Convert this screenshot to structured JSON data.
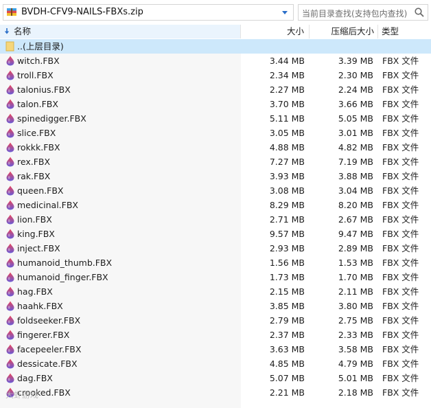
{
  "path": {
    "text": "BVDH-CFV9-NAILS-FBXs.zip"
  },
  "search": {
    "placeholder": "当前目录查找(支持包内查找)"
  },
  "columns": {
    "name": "名称",
    "size": "大小",
    "packed": "压缩后大小",
    "type": "类型"
  },
  "up_row": {
    "label": "..(上层目录)"
  },
  "files": [
    {
      "name": "witch.FBX",
      "size": "3.44 MB",
      "packed": "3.39 MB",
      "type": "FBX 文件"
    },
    {
      "name": "troll.FBX",
      "size": "2.34 MB",
      "packed": "2.30 MB",
      "type": "FBX 文件"
    },
    {
      "name": "talonius.FBX",
      "size": "2.27 MB",
      "packed": "2.24 MB",
      "type": "FBX 文件"
    },
    {
      "name": "talon.FBX",
      "size": "3.70 MB",
      "packed": "3.66 MB",
      "type": "FBX 文件"
    },
    {
      "name": "spinedigger.FBX",
      "size": "5.11 MB",
      "packed": "5.05 MB",
      "type": "FBX 文件"
    },
    {
      "name": "slice.FBX",
      "size": "3.05 MB",
      "packed": "3.01 MB",
      "type": "FBX 文件"
    },
    {
      "name": "rokkk.FBX",
      "size": "4.88 MB",
      "packed": "4.82 MB",
      "type": "FBX 文件"
    },
    {
      "name": "rex.FBX",
      "size": "7.27 MB",
      "packed": "7.19 MB",
      "type": "FBX 文件"
    },
    {
      "name": "rak.FBX",
      "size": "3.93 MB",
      "packed": "3.88 MB",
      "type": "FBX 文件"
    },
    {
      "name": "queen.FBX",
      "size": "3.08 MB",
      "packed": "3.04 MB",
      "type": "FBX 文件"
    },
    {
      "name": "medicinal.FBX",
      "size": "8.29 MB",
      "packed": "8.20 MB",
      "type": "FBX 文件"
    },
    {
      "name": "lion.FBX",
      "size": "2.71 MB",
      "packed": "2.67 MB",
      "type": "FBX 文件"
    },
    {
      "name": "king.FBX",
      "size": "9.57 MB",
      "packed": "9.47 MB",
      "type": "FBX 文件"
    },
    {
      "name": "inject.FBX",
      "size": "2.93 MB",
      "packed": "2.89 MB",
      "type": "FBX 文件"
    },
    {
      "name": "humanoid_thumb.FBX",
      "size": "1.56 MB",
      "packed": "1.53 MB",
      "type": "FBX 文件"
    },
    {
      "name": "humanoid_finger.FBX",
      "size": "1.73 MB",
      "packed": "1.70 MB",
      "type": "FBX 文件"
    },
    {
      "name": "hag.FBX",
      "size": "2.15 MB",
      "packed": "2.11 MB",
      "type": "FBX 文件"
    },
    {
      "name": "haahk.FBX",
      "size": "3.85 MB",
      "packed": "3.80 MB",
      "type": "FBX 文件"
    },
    {
      "name": "foldseeker.FBX",
      "size": "2.79 MB",
      "packed": "2.75 MB",
      "type": "FBX 文件"
    },
    {
      "name": "fingerer.FBX",
      "size": "2.37 MB",
      "packed": "2.33 MB",
      "type": "FBX 文件"
    },
    {
      "name": "facepeeler.FBX",
      "size": "3.63 MB",
      "packed": "3.58 MB",
      "type": "FBX 文件"
    },
    {
      "name": "dessicate.FBX",
      "size": "4.85 MB",
      "packed": "4.79 MB",
      "type": "FBX 文件"
    },
    {
      "name": "dag.FBX",
      "size": "5.07 MB",
      "packed": "5.01 MB",
      "type": "FBX 文件"
    },
    {
      "name": "crooked.FBX",
      "size": "2.21 MB",
      "packed": "2.18 MB",
      "type": "FBX 文件"
    }
  ],
  "watermark": "大虾游戏",
  "colors": {
    "selected_row": "#cde8fb",
    "name_column": "#f7f7f7",
    "fbx_icon_top": "#e8455a",
    "fbx_icon_bottom": "#6a5bd6"
  }
}
